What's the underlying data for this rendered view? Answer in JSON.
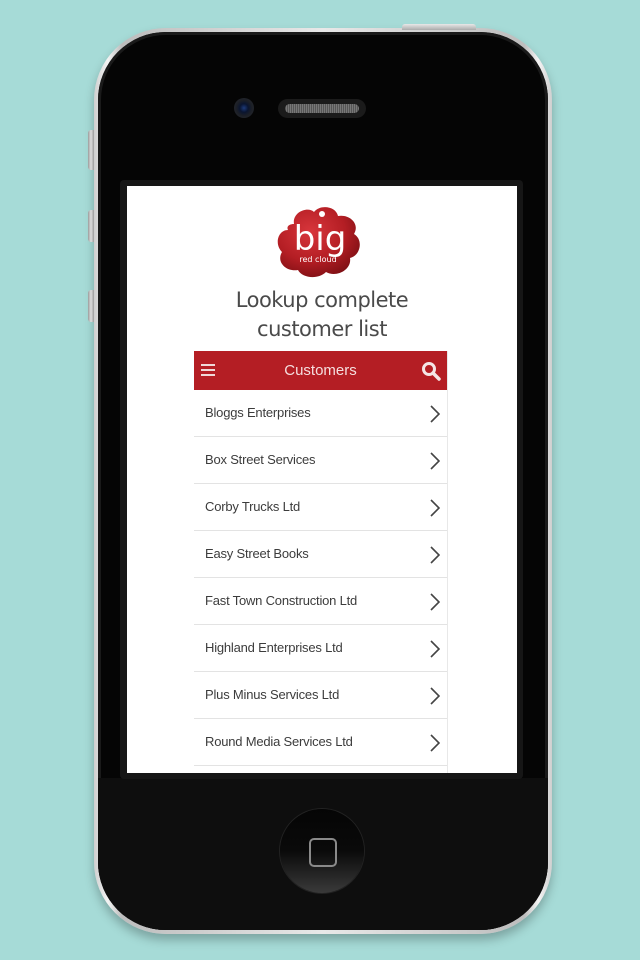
{
  "device": {
    "name": "iPhone mockup",
    "background_color": "#a6dbd7"
  },
  "promo": {
    "logo": {
      "brand_main": "big",
      "brand_sub": "red cloud",
      "color": "#b41e24"
    },
    "heading_line1": "Lookup complete",
    "heading_line2": "customer list"
  },
  "app": {
    "appbar": {
      "title": "Customers",
      "menu_icon": "hamburger-menu-icon",
      "search_icon": "search-icon",
      "color": "#b41e24"
    },
    "customers": [
      {
        "name": "Bloggs Enterprises"
      },
      {
        "name": "Box Street Services"
      },
      {
        "name": "Corby Trucks Ltd"
      },
      {
        "name": "Easy Street Books"
      },
      {
        "name": "Fast Town Construction Ltd"
      },
      {
        "name": "Highland Enterprises Ltd"
      },
      {
        "name": "Plus Minus Services Ltd"
      },
      {
        "name": "Round Media Services Ltd"
      }
    ],
    "row_icon": "chevron-right-icon"
  }
}
